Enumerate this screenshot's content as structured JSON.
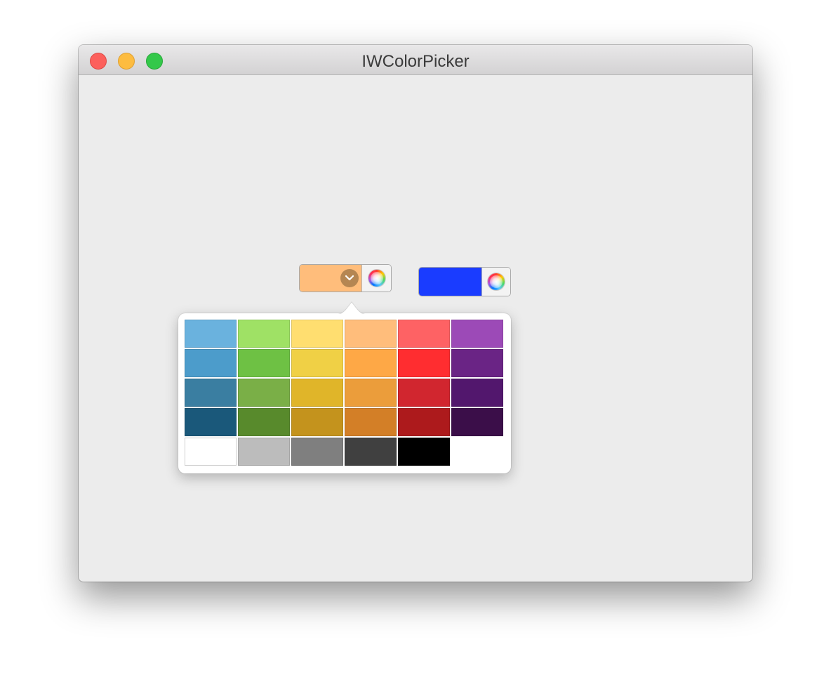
{
  "window": {
    "title": "IWColorPicker"
  },
  "wells": [
    {
      "color": "#ffbd7b",
      "has_dropdown": true,
      "state": "popover-open"
    },
    {
      "color": "#1a3cff",
      "has_dropdown": false
    }
  ],
  "popover": {
    "swatches": [
      [
        "#6ab2de",
        "#9fe165",
        "#ffde70",
        "#ffbd7b",
        "#fe6264",
        "#9c4ab7"
      ],
      [
        "#4c9ccb",
        "#6ec144",
        "#f0d045",
        "#fea846",
        "#ff2d30",
        "#6a2485"
      ],
      [
        "#3a7ea1",
        "#7aaf47",
        "#e0b529",
        "#eb9d3b",
        "#d1262f",
        "#52176d"
      ],
      [
        "#1a587a",
        "#588a2c",
        "#c4931d",
        "#d37f27",
        "#ad1a1c",
        "#3b0e49"
      ],
      [
        "#ffffff",
        "#bcbcbc",
        "#7f7f7f",
        "#404040",
        "#000000",
        ""
      ]
    ]
  },
  "icons": {
    "close": "close-icon",
    "minimize": "minimize-icon",
    "zoom": "zoom-icon",
    "color_wheel": "color-wheel-icon",
    "chevron": "chevron-down-icon"
  }
}
